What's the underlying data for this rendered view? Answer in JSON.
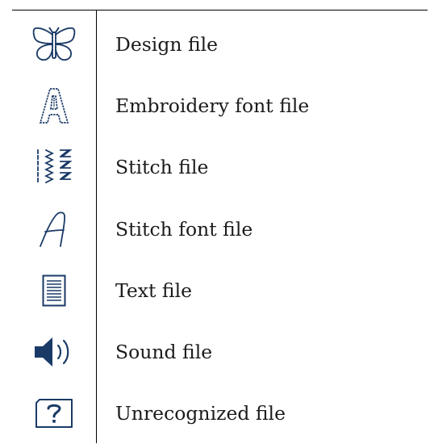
{
  "legend": {
    "rows": [
      {
        "icon": "butterfly-icon",
        "label": "Design file"
      },
      {
        "icon": "letter-a-icon",
        "label": "Embroidery font file"
      },
      {
        "icon": "stitch-pattern-icon",
        "label": "Stitch file"
      },
      {
        "icon": "script-a-icon",
        "label": "Stitch font file"
      },
      {
        "icon": "document-icon",
        "label": "Text file"
      },
      {
        "icon": "speaker-icon",
        "label": "Sound file"
      },
      {
        "icon": "question-folder-icon",
        "label": "Unrecognized file"
      }
    ]
  },
  "colors": {
    "icon": "#1a3a66",
    "text": "#1c1c1c",
    "rule": "#000000"
  }
}
